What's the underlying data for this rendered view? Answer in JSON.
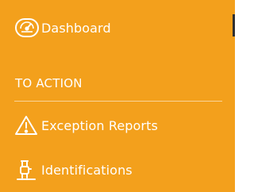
{
  "colors": {
    "background": "#F3A01C",
    "text": "#FFFFFF",
    "scroll_indicator": "#303030"
  },
  "nav": {
    "dashboard": {
      "label": "Dashboard",
      "icon": "speedometer-icon"
    },
    "section": {
      "title": "TO ACTION"
    },
    "exception_reports": {
      "label": "Exception Reports",
      "icon": "warning-triangle-icon"
    },
    "identifications": {
      "label": "Identifications",
      "icon": "wristband-watch-icon"
    }
  }
}
